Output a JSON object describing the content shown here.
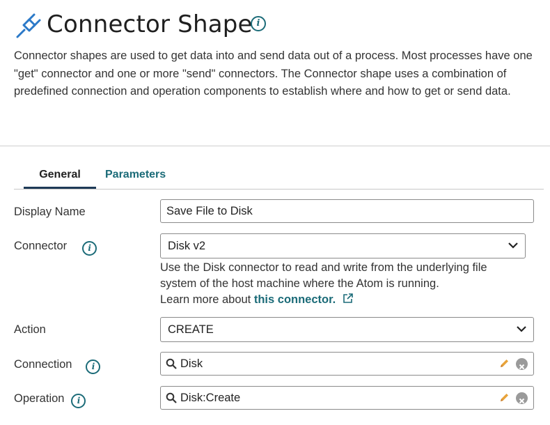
{
  "header": {
    "title": "Connector Shape",
    "icon": "plug-icon",
    "info_icon": "info-icon",
    "description": "Connector shapes are used to get data into and send data out of a process. Most processes have one \"get\" connector and one or more \"send\" connectors. The Connector shape uses a combination of predefined connection and operation components to establish where and how to get or send data."
  },
  "tabs": [
    {
      "label": "General",
      "active": true
    },
    {
      "label": "Parameters",
      "active": false
    }
  ],
  "form": {
    "display_name": {
      "label": "Display Name",
      "value": "Save File to Disk"
    },
    "connector": {
      "label": "Connector",
      "value": "Disk v2",
      "help_line1": "Use the Disk connector to read and write from the underlying file",
      "help_line2": "system of the host machine where the Atom is running.",
      "learn_prefix": "Learn more about ",
      "learn_link": "this connector."
    },
    "action": {
      "label": "Action",
      "value": "CREATE"
    },
    "connection": {
      "label": "Connection",
      "value": "Disk"
    },
    "operation": {
      "label": "Operation",
      "value": "Disk:Create"
    }
  },
  "colors": {
    "accent": "#1b6b78",
    "plug_icon": "#2b79c8",
    "tab_underline": "#1e3a57",
    "pencil": "#e8a33a",
    "clear_button": "#9a9a9a"
  }
}
